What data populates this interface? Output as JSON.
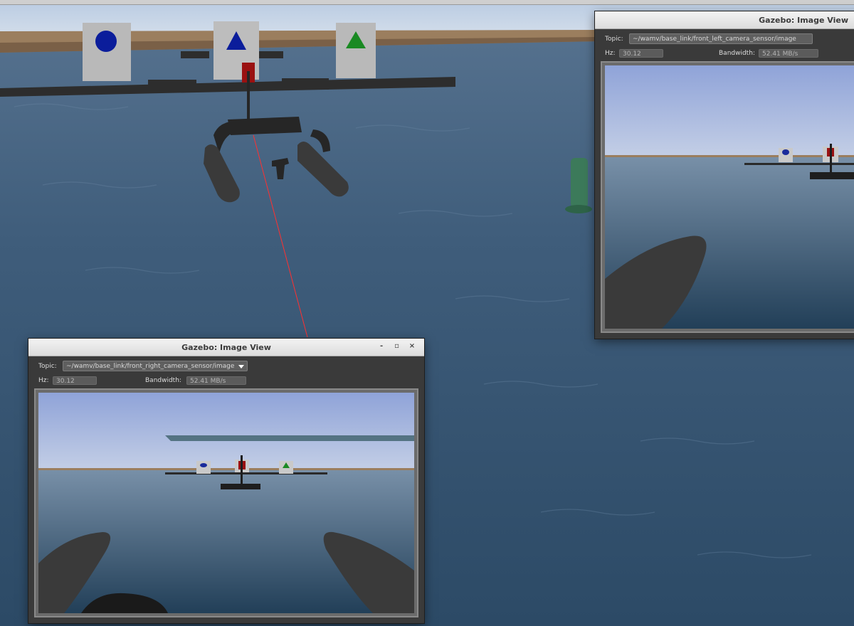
{
  "windows": {
    "left_camera": {
      "title": "Gazebo: Image View",
      "topic_label": "Topic:",
      "topic_value": "~/wamv/base_link/front_left_camera_sensor/image",
      "hz_label": "Hz:",
      "hz_value": "30.12",
      "bandwidth_label": "Bandwidth:",
      "bandwidth_value": "52.41 MB/s"
    },
    "right_camera": {
      "title": "Gazebo: Image View",
      "topic_label": "Topic:",
      "topic_value": "~/wamv/base_link/front_right_camera_sensor/image",
      "hz_label": "Hz:",
      "hz_value": "30.12",
      "bandwidth_label": "Bandwidth:",
      "bandwidth_value": "52.41 MB/s",
      "controls": {
        "minimize": "-",
        "maximize": "▫",
        "close": "×"
      }
    }
  },
  "icons": {
    "dropdown": "triangle-down",
    "window_controls": [
      "minimize-icon",
      "maximize-icon",
      "close-icon"
    ],
    "placard_symbols": [
      "blue-circle",
      "blue-triangle",
      "green-triangle"
    ]
  },
  "colors": {
    "sky": "#c4d3e4",
    "water": "#3a5a78",
    "window_bg": "#3a3a3a",
    "titlebar": "#e3e3e3",
    "laser": "#ff3030"
  }
}
